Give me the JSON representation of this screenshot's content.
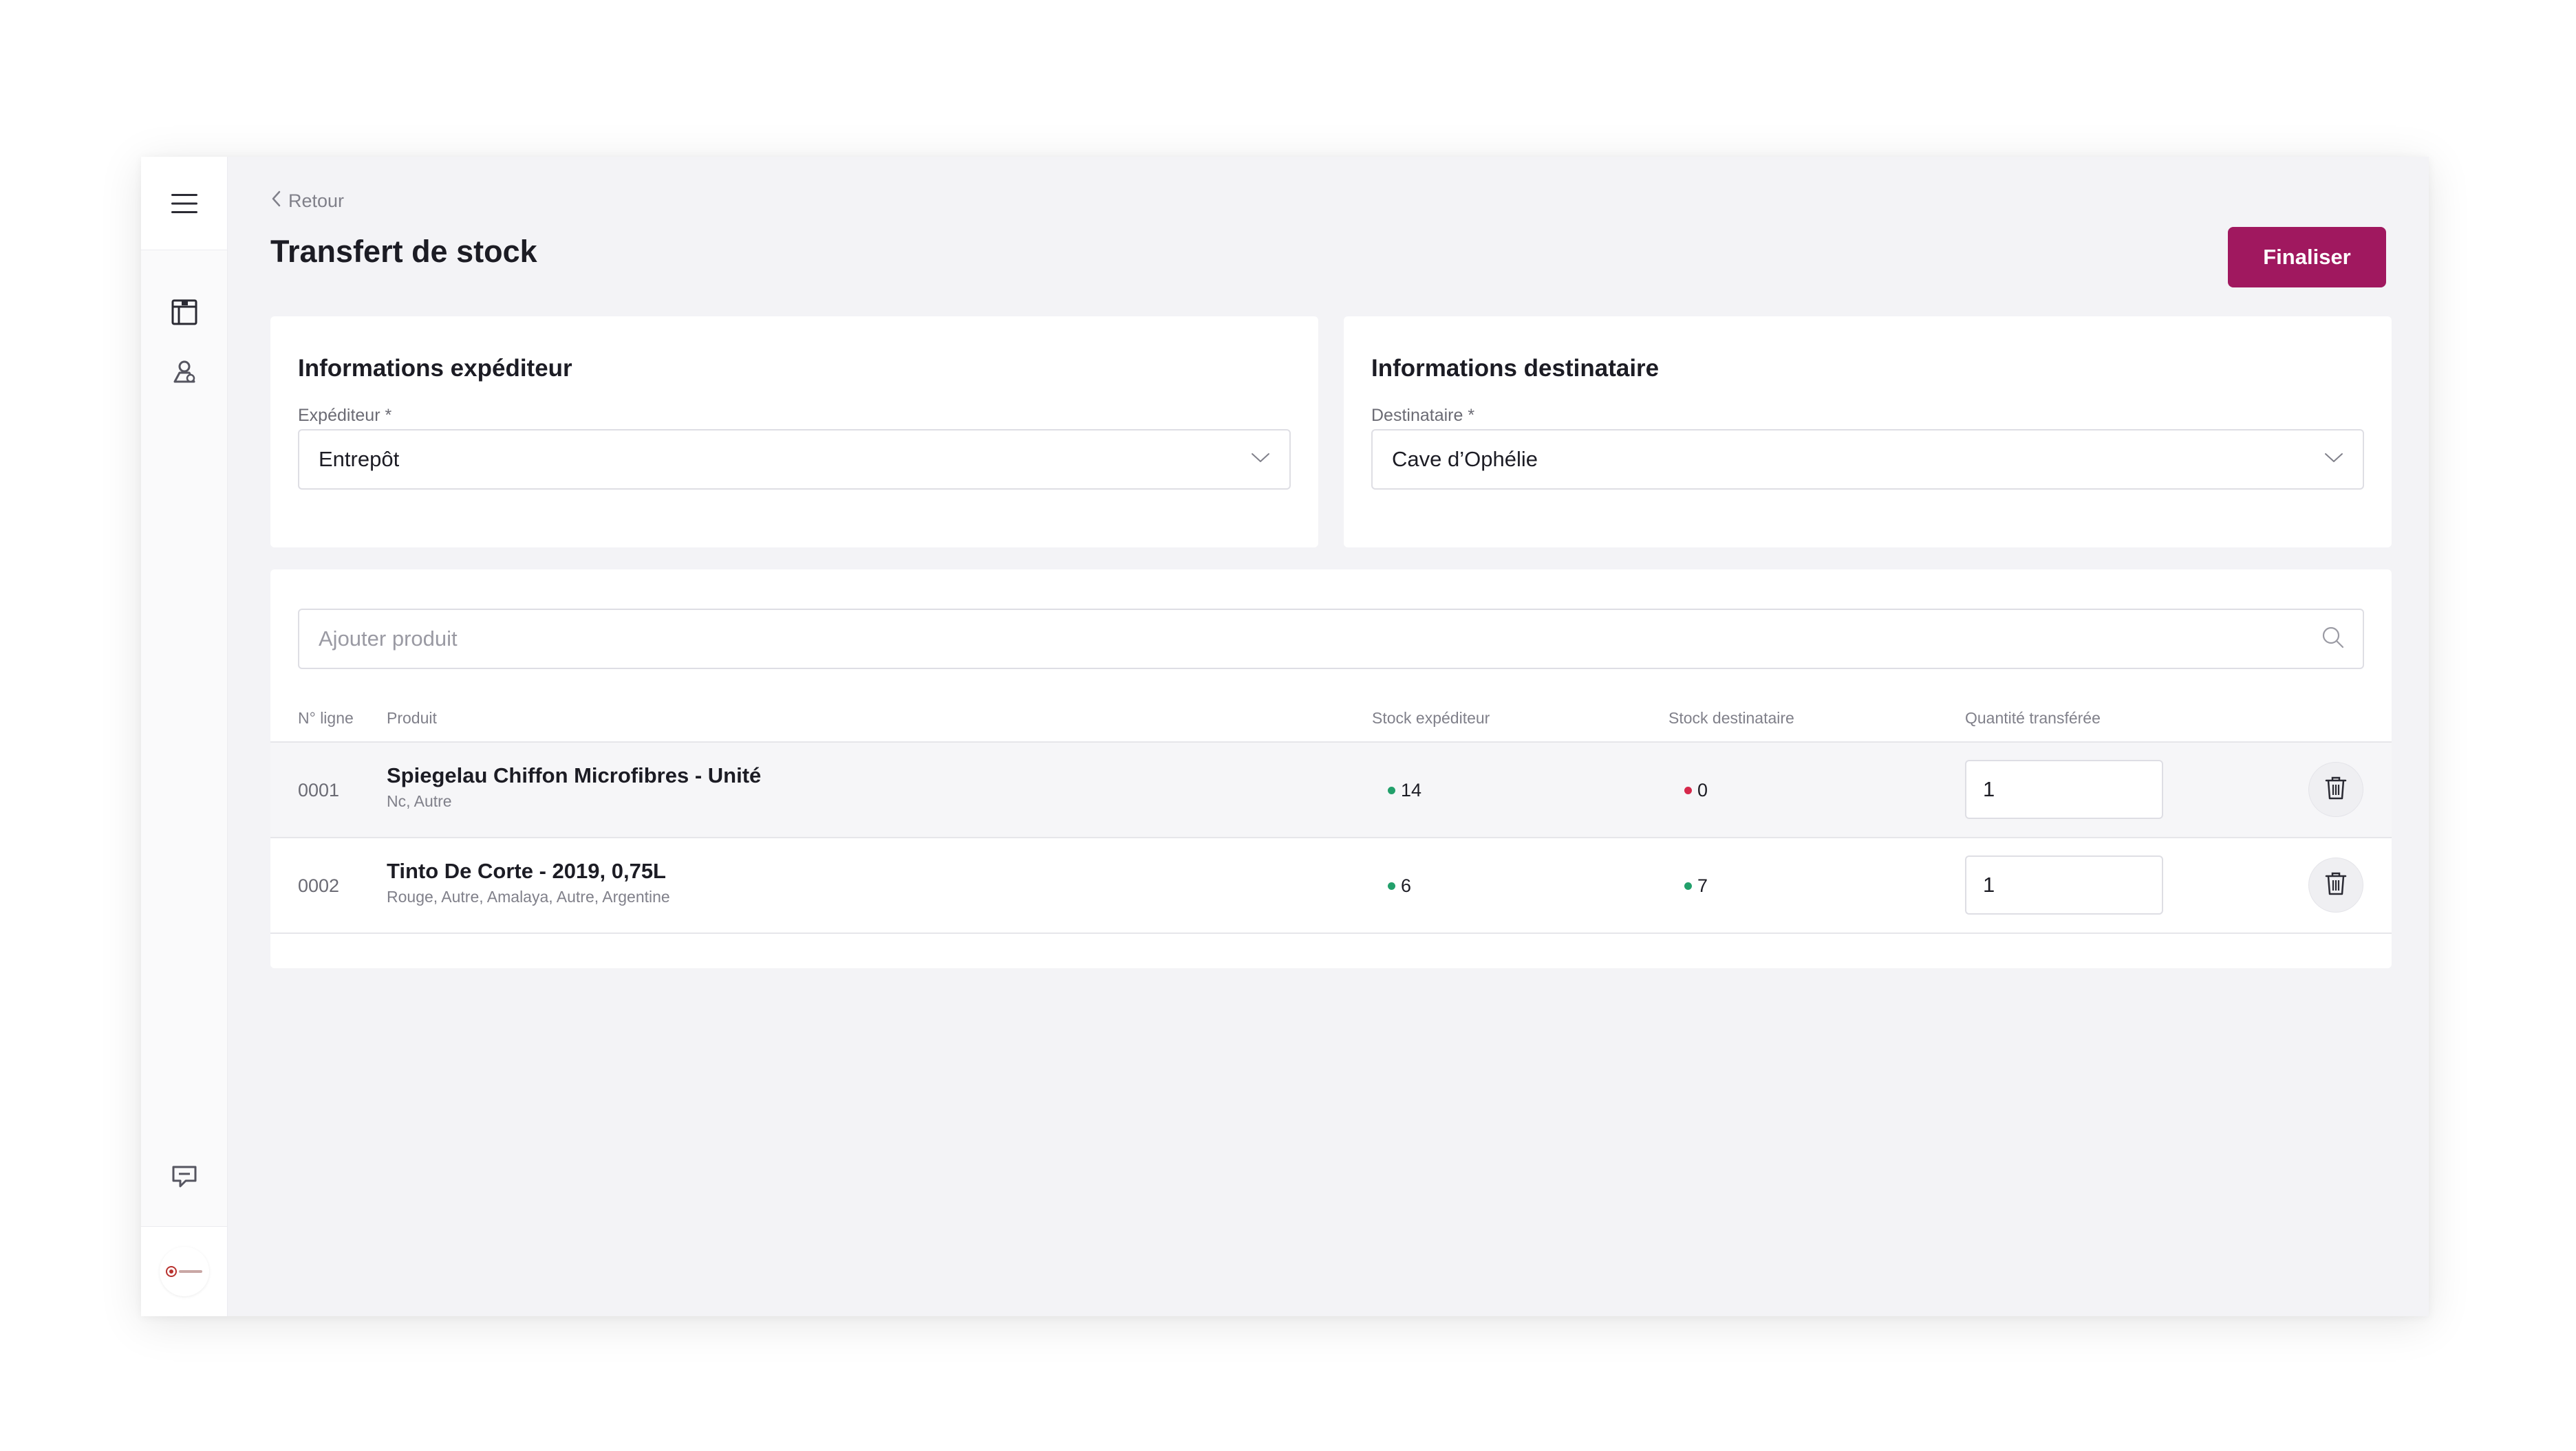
{
  "nav": {
    "back_label": "Retour",
    "page_title": "Transfert de stock",
    "finalize_label": "Finaliser"
  },
  "sender": {
    "title": "Informations expéditeur",
    "field_label": "Expéditeur *",
    "value": "Entrepôt"
  },
  "recipient": {
    "title": "Informations destinataire",
    "field_label": "Destinataire *",
    "value": "Cave d’Ophélie"
  },
  "products": {
    "search_placeholder": "Ajouter produit",
    "columns": {
      "line": "N° ligne",
      "product": "Produit",
      "stock_sender": "Stock expéditeur",
      "stock_recipient": "Stock destinataire",
      "quantity": "Quantité transférée"
    },
    "rows": [
      {
        "line": "0001",
        "name": "Spiegelau Chiffon Microfibres - Unité",
        "details": "Nc, Autre",
        "stock_sender": "14",
        "stock_sender_color": "#22a06b",
        "stock_recipient": "0",
        "stock_recipient_color": "#d6284b",
        "quantity": "1"
      },
      {
        "line": "0002",
        "name": "Tinto De Corte - 2019, 0,75L",
        "details": "Rouge, Autre, Amalaya, Autre, Argentine",
        "stock_sender": "6",
        "stock_sender_color": "#22a06b",
        "stock_recipient": "7",
        "stock_recipient_color": "#22a06b",
        "quantity": "1"
      }
    ]
  },
  "icons": {
    "menu": "hamburger-menu-icon",
    "catalog": "catalog-icon",
    "contacts": "contacts-icon",
    "chat": "chat-icon",
    "search": "search-icon",
    "chevron": "chevron-down-icon",
    "delete": "trash-icon"
  },
  "colors": {
    "accent": "#a0185f",
    "in_stock": "#22a06b",
    "out_of_stock": "#d6284b"
  }
}
